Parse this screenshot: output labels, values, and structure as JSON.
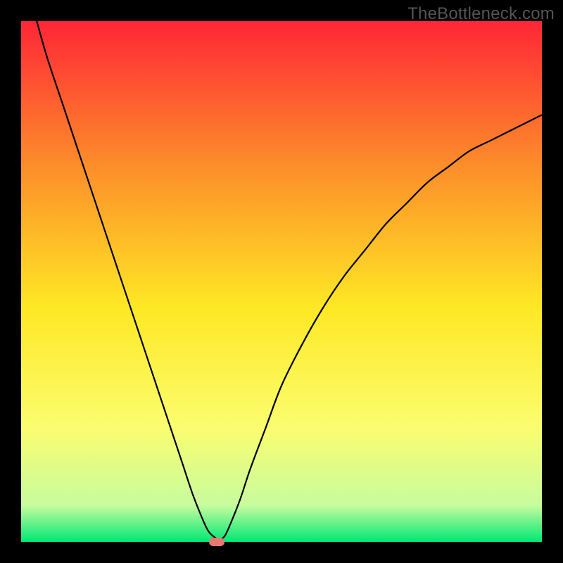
{
  "watermark": "TheBottleneck.com",
  "chart_data": {
    "type": "line",
    "title": "",
    "xlabel": "",
    "ylabel": "",
    "xlim": [
      0,
      100
    ],
    "ylim": [
      0,
      100
    ],
    "grid": false,
    "legend": false,
    "background_gradient": {
      "top": "#fe2636",
      "upper_mid": "#fd8e2a",
      "mid": "#fee824",
      "lower_mid": "#fbfd6f",
      "near_bottom": "#c7fc9e",
      "bottom": "#00e874"
    },
    "series": [
      {
        "name": "bottleneck-curve",
        "color": "#000000",
        "x": [
          3,
          5,
          8,
          11,
          14,
          17,
          20,
          23,
          26,
          29,
          31,
          33,
          35,
          36,
          37,
          38,
          39,
          40,
          42,
          44,
          47,
          50,
          54,
          58,
          62,
          66,
          70,
          74,
          78,
          82,
          86,
          90,
          94,
          98,
          100
        ],
        "y": [
          100,
          93,
          84,
          75,
          66,
          57,
          48,
          39,
          30,
          21,
          15,
          9,
          4,
          2,
          1,
          0.5,
          1,
          3,
          8,
          14,
          22,
          30,
          38,
          45,
          51,
          56,
          61,
          65,
          69,
          72,
          75,
          77,
          79,
          81,
          82
        ]
      }
    ],
    "marker": {
      "x": 37.5,
      "y": 0,
      "color": "#e77a6f",
      "shape": "rounded-rect"
    }
  }
}
